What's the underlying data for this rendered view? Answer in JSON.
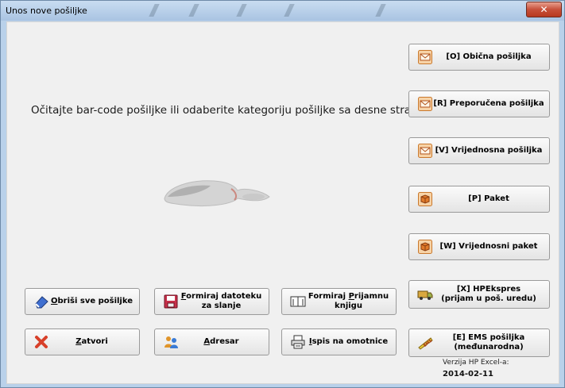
{
  "window": {
    "title": "Unos nove pošiljke",
    "close_glyph": "✕"
  },
  "prompt": "Očitajte bar-code pošiljke ili odaberite kategoriju pošiljke sa desne strane",
  "categories": [
    {
      "label": "[O] Obična pošiljka",
      "icon": "envelope-icon"
    },
    {
      "label": "[R] Preporučena  pošiljka",
      "icon": "envelope-icon"
    },
    {
      "label": "[V] Vrijednosna pošiljka",
      "icon": "envelope-icon"
    },
    {
      "label": "[P] Paket",
      "icon": "package-icon"
    },
    {
      "label": "[W] Vrijednosni paket",
      "icon": "package-icon"
    },
    {
      "label_line1": "[X] HPEkspres",
      "label_line2": "(prijam u poš. uredu)",
      "icon": "delivery-van-icon"
    },
    {
      "label_line1": "[E] EMS pošiljka",
      "label_line2": "(međunarodna)",
      "icon": "ems-icon"
    }
  ],
  "actions": {
    "delete_all": {
      "accel": "O",
      "rest": "briši sve pošiljke",
      "icon": "eraser-icon"
    },
    "create_file": {
      "accel": "F",
      "rest_line1": "ormiraj datoteku",
      "line2": "za slanje",
      "icon": "floppy-disk-icon"
    },
    "create_book": {
      "line1_prefix": "Formiraj ",
      "accel": "P",
      "line1_rest": "rijamnu",
      "line2": "knjigu",
      "icon": "book-icon"
    },
    "close": {
      "accel": "Z",
      "rest": "atvori",
      "icon": "close-x-icon"
    },
    "address_book": {
      "accel": "A",
      "rest": "dresar",
      "icon": "contacts-icon"
    },
    "print_envelopes": {
      "accel": "I",
      "rest": "spis na omotnice",
      "icon": "printer-icon"
    }
  },
  "version": {
    "label": "Verzija HP Excel-a:",
    "date": "2014-02-11"
  },
  "colors": {
    "title_bar": "#b9d1ea",
    "close_button": "#c7503a",
    "client_bg": "#f0f0f0",
    "button_bg": "#e9e9e9"
  }
}
